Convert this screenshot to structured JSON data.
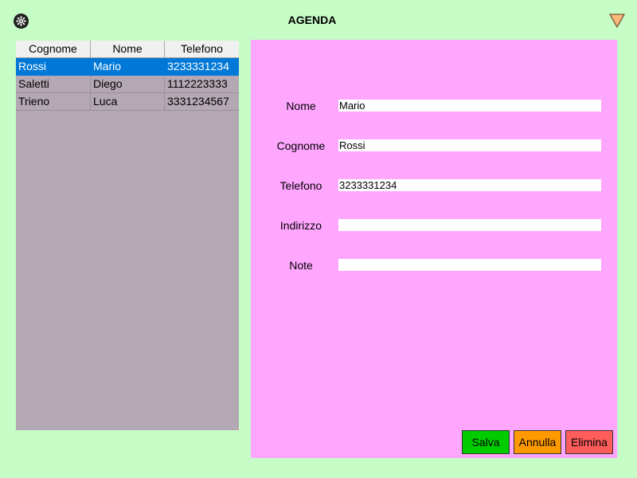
{
  "window": {
    "title": "AGENDA",
    "left_icon": "settings-gear-icon",
    "right_icon": "triangle-down-icon"
  },
  "table": {
    "headers": [
      "Cognome",
      "Nome",
      "Telefono"
    ],
    "rows": [
      {
        "cognome": "Rossi",
        "nome": "Mario",
        "telefono": "3233331234",
        "selected": true
      },
      {
        "cognome": "Saletti",
        "nome": "Diego",
        "telefono": "1112223333",
        "selected": false
      },
      {
        "cognome": "Trieno",
        "nome": "Luca",
        "telefono": "3331234567",
        "selected": false
      }
    ]
  },
  "form": {
    "fields": [
      {
        "label": "Nome",
        "value": "Mario"
      },
      {
        "label": "Cognome",
        "value": "Rossi"
      },
      {
        "label": "Telefono",
        "value": "3233331234"
      },
      {
        "label": "Indirizzo",
        "value": ""
      },
      {
        "label": "Note",
        "value": ""
      }
    ]
  },
  "buttons": {
    "save_label": "Salva",
    "cancel_label": "Annulla",
    "delete_label": "Elimina"
  },
  "colors": {
    "background": "#c6fcc6",
    "table_bg": "#b3a8b3",
    "selection": "#0078d7",
    "form_bg": "#ffa6ff",
    "save": "#00cc00",
    "cancel": "#ff9900",
    "delete": "#ff5c5c"
  }
}
